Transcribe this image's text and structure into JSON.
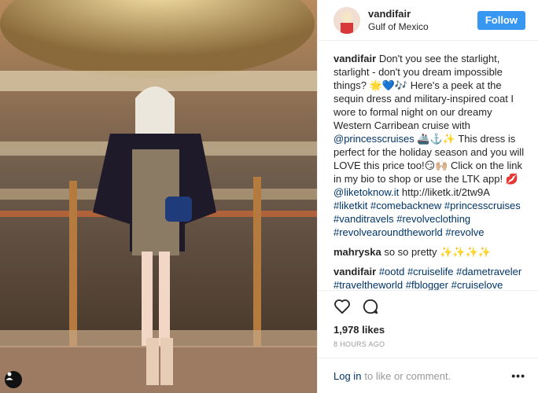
{
  "post": {
    "username": "vandifair",
    "location": "Gulf of Mexico",
    "follow_label": "Follow"
  },
  "comments": [
    {
      "user": "vandifair",
      "text": "Don't you see the starlight, starlight - don't you dream impossible things? 🌟💙🎶 Here's a peek at the sequin dress and military-inspired coat I wore to formal night on our dreamy Western Carribean cruise with ",
      "mention": "@princesscruises",
      "text2": " 🚢⚓️✨ This dress is perfect for the holiday season and you will LOVE this price too!😏🙌🏼 Click on the link in my bio to shop or use the LTK app! 💋 ",
      "mention2": "@liketoknow.it",
      "text3": " http://liketk.it/2tw9A ",
      "tags": "#liketkit #comebacknew #princesscruises #vanditravels #revolveclothing #revolvearoundtheworld #revolve"
    },
    {
      "user": "mahryska",
      "text": "so so pretty ✨✨✨✨"
    },
    {
      "user": "vandifair",
      "tags": "#ootd #cruiselife #dametraveler #traveltheworld #fblogger #cruiselove #travelblog #travelblogger #globetrotter #ootd #traveltheworld #lotd #outfitoftheday #lookoftheday #dallasblogger #cruiseship"
    }
  ],
  "likes": "1,978 likes",
  "time": "8 HOURS AGO",
  "login": {
    "link": "Log in",
    "rest": "to like or comment.",
    "more": "•••"
  },
  "icons": {
    "like": "heart-icon",
    "comment": "comment-icon",
    "tag": "person-tag-icon",
    "more": "more-icon"
  }
}
